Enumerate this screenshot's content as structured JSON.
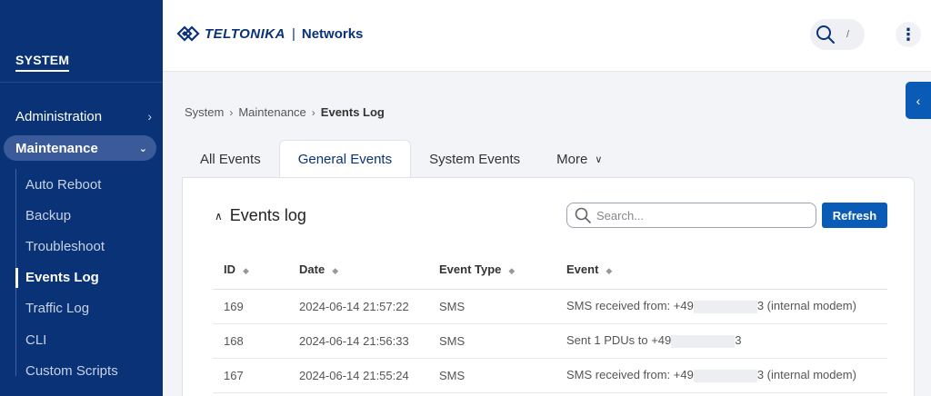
{
  "sidebar": {
    "section_title": "SYSTEM",
    "top_item": "Administration",
    "active_group": "Maintenance",
    "items": [
      {
        "label": "Auto Reboot"
      },
      {
        "label": "Backup"
      },
      {
        "label": "Troubleshoot"
      },
      {
        "label": "Events Log"
      },
      {
        "label": "Traffic Log"
      },
      {
        "label": "CLI"
      },
      {
        "label": "Custom Scripts"
      }
    ]
  },
  "header": {
    "brand": "TELTONIKA",
    "separator": "|",
    "networks": "Networks",
    "search_shortcut": "/"
  },
  "breadcrumb": {
    "items": [
      "System",
      "Maintenance"
    ],
    "current": "Events Log"
  },
  "tabs": [
    {
      "label": "All Events"
    },
    {
      "label": "General Events"
    },
    {
      "label": "System Events"
    },
    {
      "label": "More"
    }
  ],
  "card": {
    "title": "Events log",
    "search_placeholder": "Search...",
    "refresh_label": "Refresh"
  },
  "table": {
    "columns": [
      "ID",
      "Date",
      "Event Type",
      "Event"
    ],
    "rows": [
      {
        "id": "169",
        "date": "2024-06-14 21:57:22",
        "type": "SMS",
        "event_prefix": "SMS received from: +49",
        "event_suffix": "3 (internal modem)"
      },
      {
        "id": "168",
        "date": "2024-06-14 21:56:33",
        "type": "SMS",
        "event_prefix": "Sent 1 PDUs to +49",
        "event_suffix": "3"
      },
      {
        "id": "167",
        "date": "2024-06-14 21:55:24",
        "type": "SMS",
        "event_prefix": "SMS received from: +49",
        "event_suffix": "3 (internal modem)"
      }
    ]
  },
  "colors": {
    "sidebar_bg": "#0a3277",
    "accent": "#0a5bb5"
  }
}
